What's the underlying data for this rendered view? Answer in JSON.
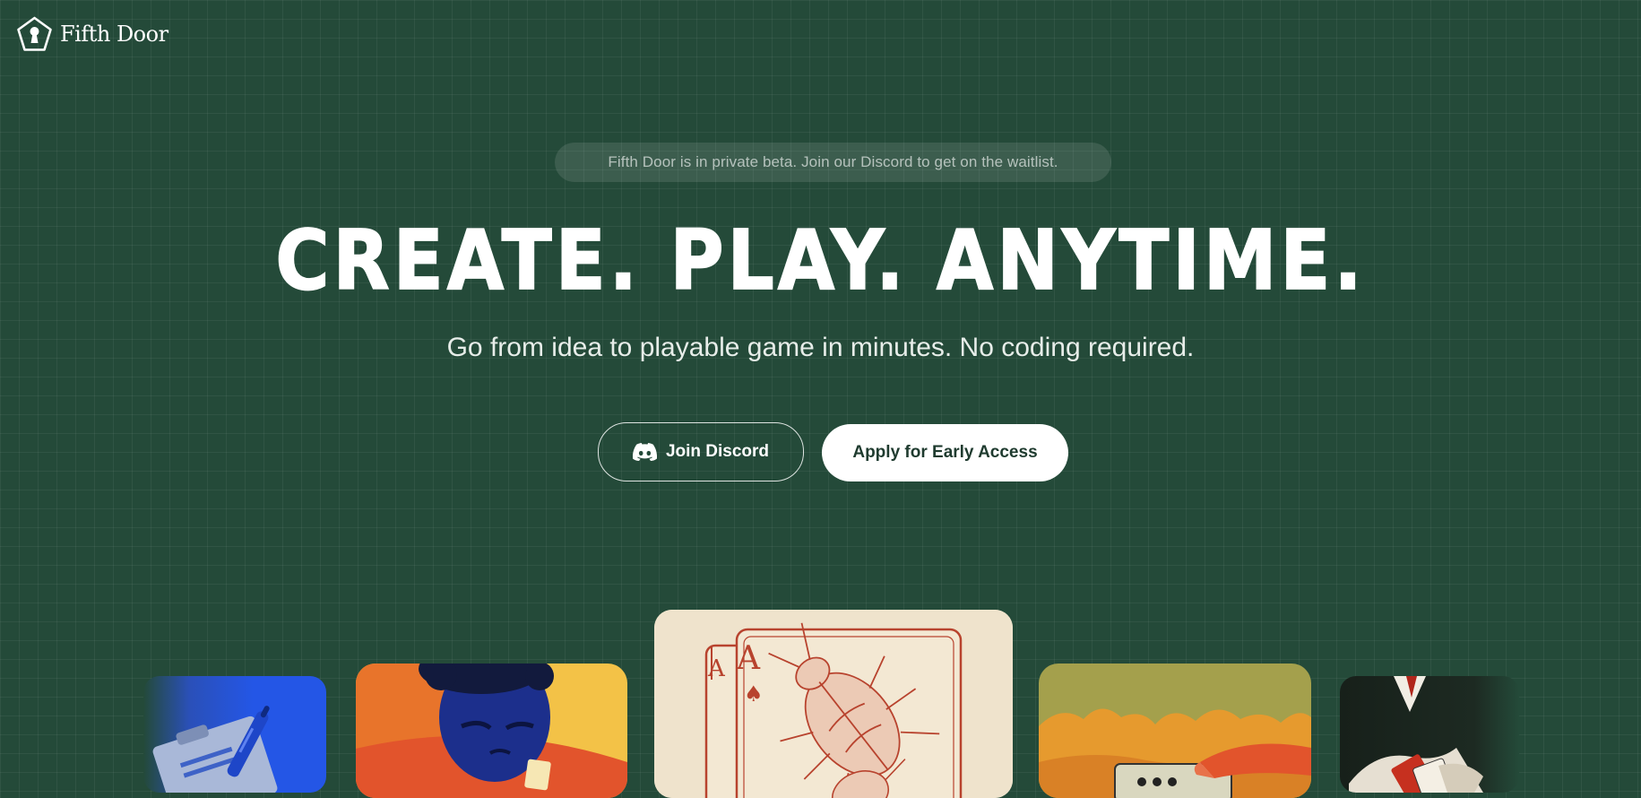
{
  "brand": {
    "name": "Fifth Door",
    "logo_icon": "keyhole-pentagon-icon"
  },
  "banner": {
    "text": "Fifth Door is in private beta. Join our Discord to get on the waitlist."
  },
  "hero": {
    "headline": "CREATE. PLAY. ANYTIME.",
    "subheadline": "Go from idea to playable game in minutes. No coding required."
  },
  "buttons": {
    "discord_label": "Join Discord",
    "discord_icon": "discord-icon",
    "apply_label": "Apply for Early Access"
  },
  "cards": {
    "center_card_rank": "A",
    "center_card_suit": "♠",
    "items": [
      {
        "name": "pen-and-notepad-illustration"
      },
      {
        "name": "kid-playing-cards-illustration"
      },
      {
        "name": "ace-of-spades-beetle-illustration"
      },
      {
        "name": "hand-pressing-button-illustration"
      },
      {
        "name": "dealer-shuffling-cards-illustration"
      }
    ]
  },
  "colors": {
    "background": "#244a39",
    "button_dark_text": "#1f3b2f",
    "card_cream": "#efe3cc",
    "card_red_ink": "#b8432e",
    "accent_blue": "#2456e6",
    "accent_yellow": "#f3c247",
    "accent_orange": "#e2542c",
    "accent_olive": "#a4a04c"
  }
}
